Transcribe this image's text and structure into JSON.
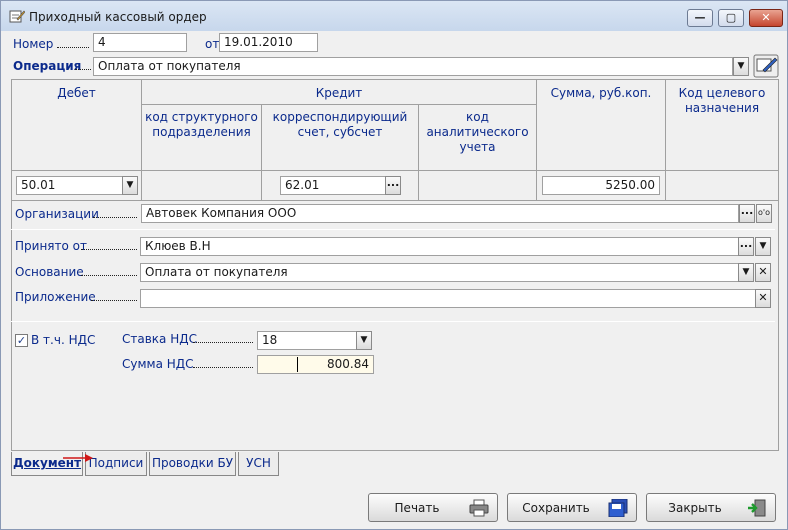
{
  "window": {
    "title": "Приходный кассовый ордер",
    "min_glyph": "—",
    "max_glyph": "▢",
    "close_glyph": "✕"
  },
  "header": {
    "number_label": "Номер",
    "number_value": "4",
    "date_label": "от",
    "date_value": "19.01.2010",
    "operation_label": "Операция",
    "operation_value": "Оплата от покупателя"
  },
  "grid": {
    "debit_header": "Дебет",
    "credit_header": "Кредит",
    "credit_sub": [
      "код структурного подразделения",
      "корреспондирующий счет, субсчет",
      "код аналитического учета"
    ],
    "amount_header": "Сумма, руб.коп.",
    "purpose_header": "Код целевого назначения",
    "debit_value": "50.01",
    "credit_account_value": "62.01",
    "amount_value": "5250.00"
  },
  "org": {
    "label": "Организации",
    "value": "Автовек Компания ООО"
  },
  "details": {
    "received_label": "Принято от",
    "received_value": "Клюев В.Н",
    "basis_label": "Основание",
    "basis_value": "Оплата от покупателя",
    "attachment_label": "Приложение",
    "attachment_value": ""
  },
  "vat": {
    "checkbox_label": "В т.ч. НДС",
    "checked": true,
    "rate_label": "Ставка НДС",
    "rate_value": "18",
    "sum_label": "Сумма НДС",
    "sum_value": "800.84"
  },
  "tabs": [
    {
      "label": "Документ",
      "active": true
    },
    {
      "label": "Подписи",
      "active": false
    },
    {
      "label": "Проводки БУ",
      "active": false
    },
    {
      "label": "УСН",
      "active": false
    }
  ],
  "buttons": {
    "print": "Печать",
    "save": "Сохранить",
    "close": "Закрыть"
  },
  "icons": {
    "dropdown": "▼",
    "ellipsis": "...",
    "clear": "✕",
    "check": "✓",
    "glasses": "о'о"
  }
}
